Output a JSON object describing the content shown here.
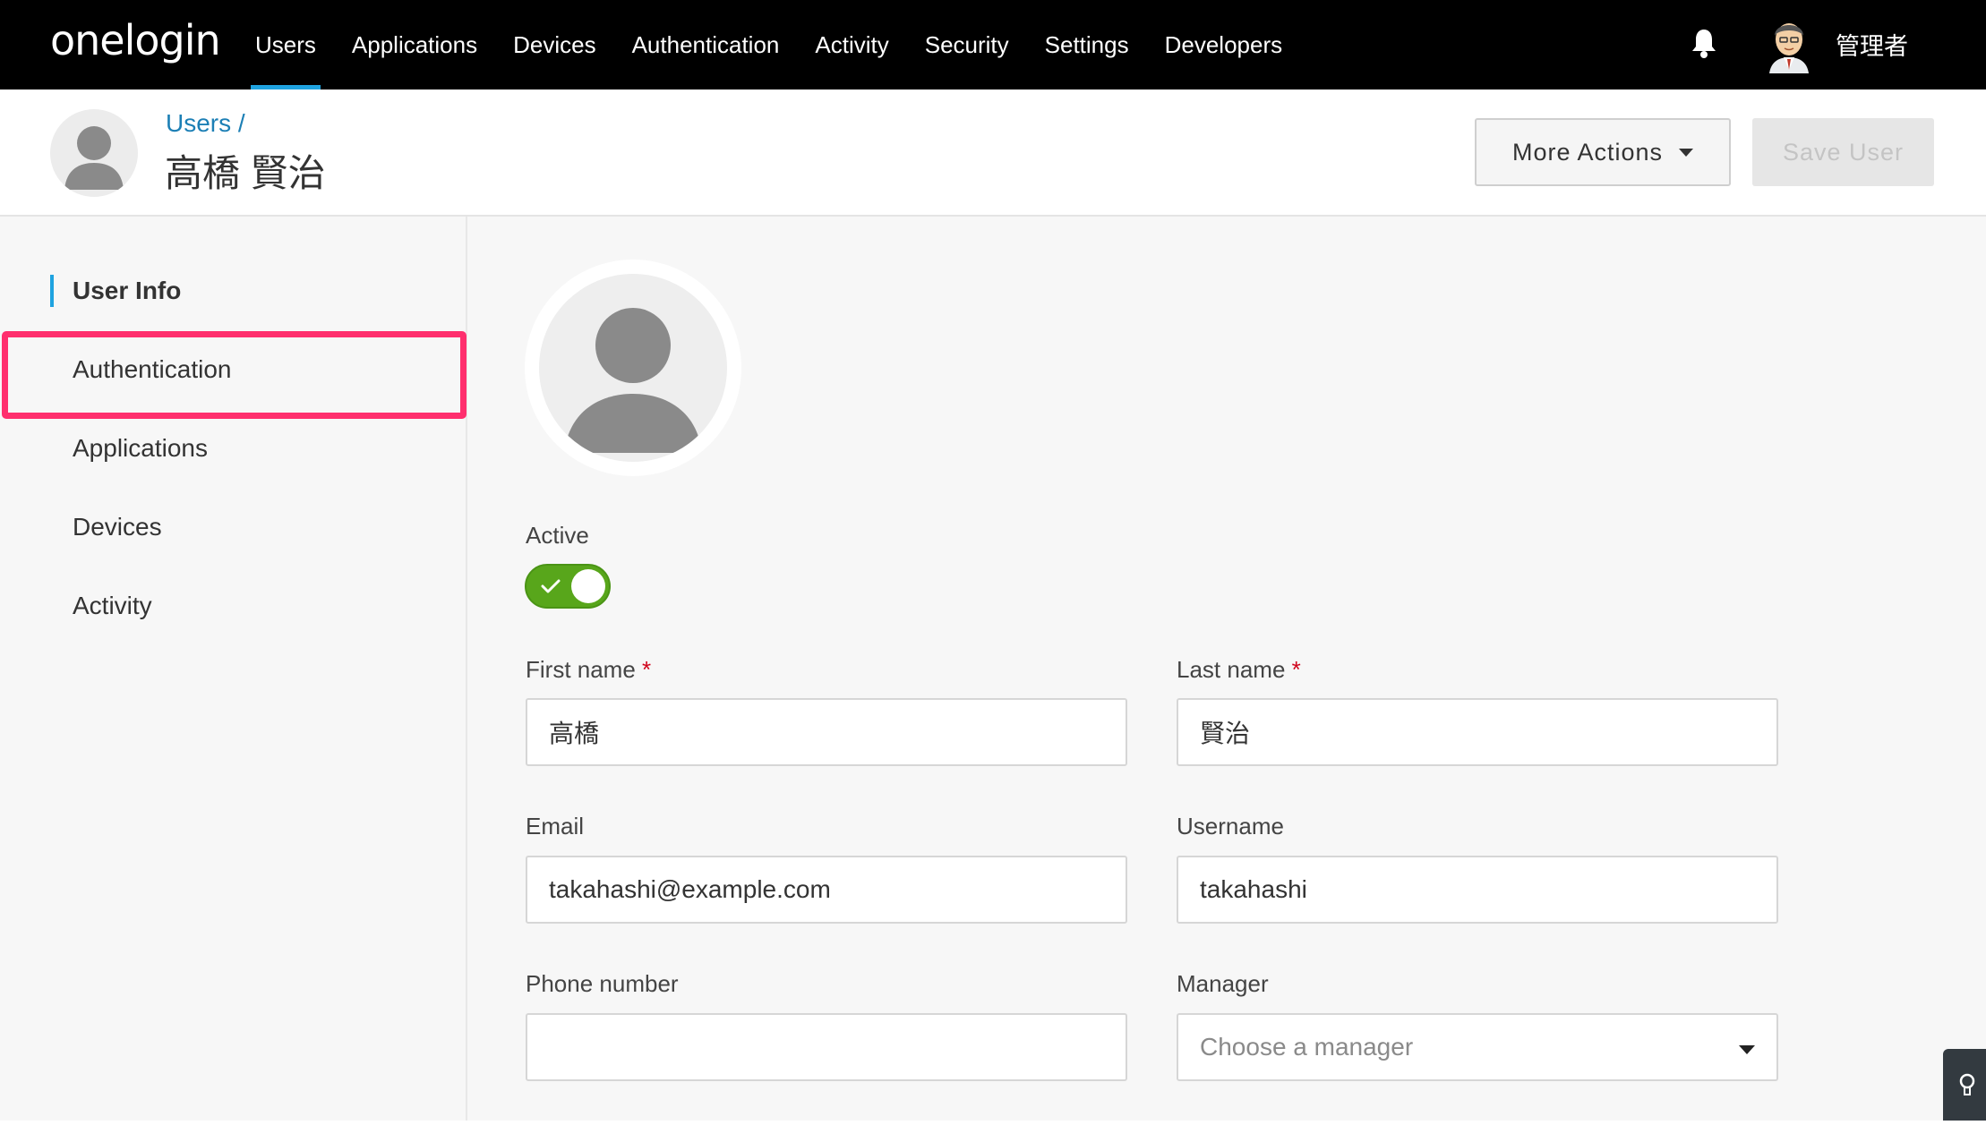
{
  "nav": {
    "logo": "onelogin",
    "items": [
      {
        "label": "Users",
        "active": true
      },
      {
        "label": "Applications",
        "active": false
      },
      {
        "label": "Devices",
        "active": false
      },
      {
        "label": "Authentication",
        "active": false
      },
      {
        "label": "Activity",
        "active": false
      },
      {
        "label": "Security",
        "active": false
      },
      {
        "label": "Settings",
        "active": false
      },
      {
        "label": "Developers",
        "active": false
      }
    ],
    "user_name": "管理者",
    "accent_color": "#1fa3e0"
  },
  "header": {
    "breadcrumb": "Users /",
    "title": "高橋 賢治",
    "more_actions_label": "More Actions",
    "save_label": "Save User"
  },
  "sidebar": {
    "items": [
      {
        "label": "User Info",
        "active": true
      },
      {
        "label": "Authentication",
        "active": false,
        "highlighted": true
      },
      {
        "label": "Applications",
        "active": false
      },
      {
        "label": "Devices",
        "active": false
      },
      {
        "label": "Activity",
        "active": false
      }
    ],
    "highlight_color": "#ff2f6e"
  },
  "form": {
    "active_label": "Active",
    "active_value": true,
    "first_name": {
      "label": "First name",
      "required_mark": "*",
      "value": "高橋"
    },
    "last_name": {
      "label": "Last name",
      "required_mark": "*",
      "value": "賢治"
    },
    "email": {
      "label": "Email",
      "value": "takahashi@example.com"
    },
    "username": {
      "label": "Username",
      "value": "takahashi"
    },
    "phone": {
      "label": "Phone number",
      "value": ""
    },
    "manager": {
      "label": "Manager",
      "placeholder": "Choose a manager"
    },
    "toggle_color": "#58a61b"
  }
}
